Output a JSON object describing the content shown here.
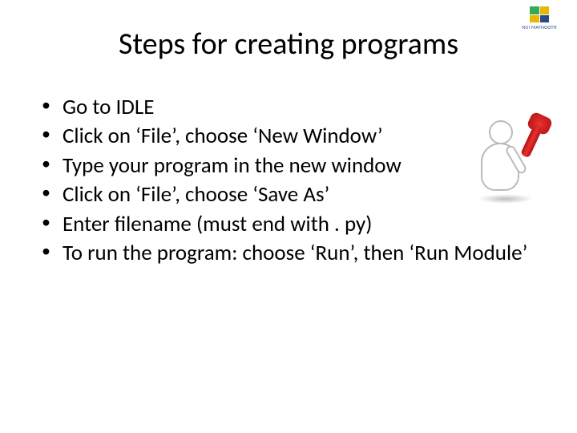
{
  "logo": {
    "text": "NUI MAYNOOTH"
  },
  "title": "Steps for creating programs",
  "steps": [
    "Go to IDLE",
    "Click on ‘File’, choose ‘New Window’",
    "Type your program in the new window",
    "Click on ‘File’, choose ‘Save As’",
    "Enter filename (must end with . py)",
    "To run the program: choose ‘Run’, then ‘Run Module’"
  ]
}
